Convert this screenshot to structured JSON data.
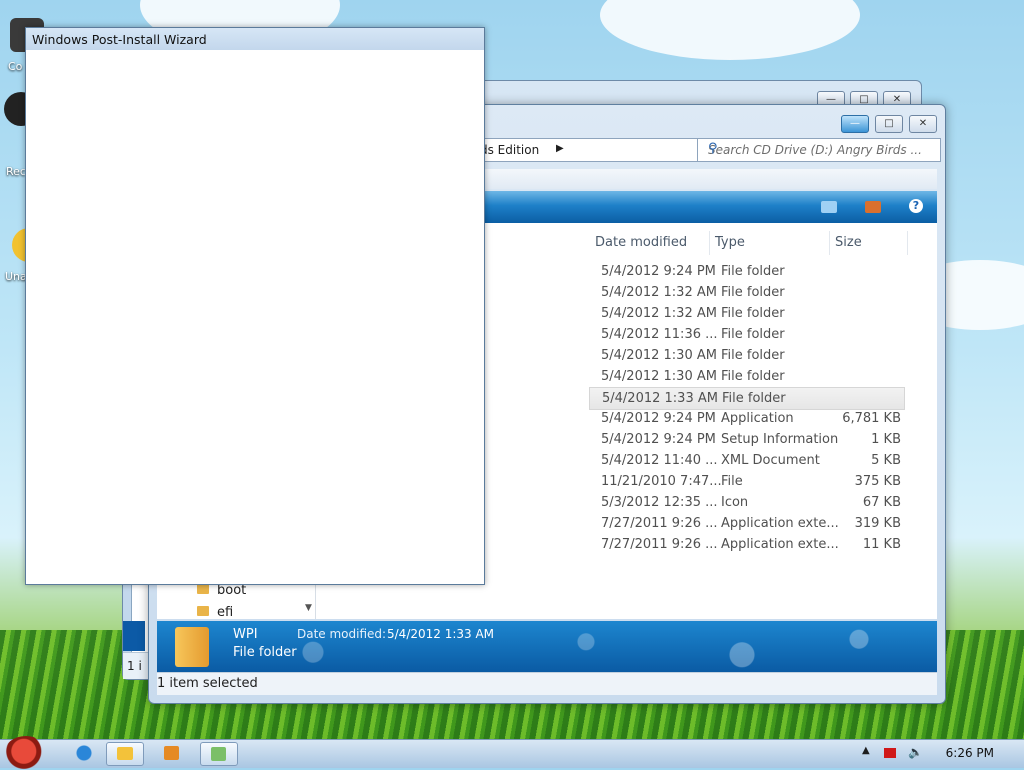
{
  "desktop": {
    "icons": [
      {
        "label": "Co",
        "icon": "computer-icon"
      },
      {
        "label": "Rec",
        "icon": "recycle-bin-icon"
      },
      {
        "label": "Una",
        "icon": "uninstall-icon"
      }
    ]
  },
  "wizard": {
    "title": "Windows Post-Install Wizard"
  },
  "back_window": {
    "status_text": "1 i"
  },
  "explorer": {
    "address_text": "ds Edition",
    "search_placeholder": "Search CD Drive (D:) Angry Birds ...",
    "columns": {
      "date_modified": "Date modified",
      "type": "Type",
      "size": "Size"
    },
    "rows": [
      {
        "date": "5/4/2012 9:24 PM",
        "type": "File folder",
        "size": ""
      },
      {
        "date": "5/4/2012 1:32 AM",
        "type": "File folder",
        "size": ""
      },
      {
        "date": "5/4/2012 1:32 AM",
        "type": "File folder",
        "size": ""
      },
      {
        "date": "5/4/2012 11:36 ...",
        "type": "File folder",
        "size": ""
      },
      {
        "date": "5/4/2012 1:30 AM",
        "type": "File folder",
        "size": ""
      },
      {
        "date": "5/4/2012 1:30 AM",
        "type": "File folder",
        "size": ""
      },
      {
        "date": "5/4/2012 1:33 AM",
        "type": "File folder",
        "size": "",
        "selected": true
      },
      {
        "date": "5/4/2012 9:24 PM",
        "type": "Application",
        "size": "6,781 KB"
      },
      {
        "date": "5/4/2012 9:24 PM",
        "type": "Setup Information",
        "size": "1 KB"
      },
      {
        "date": "5/4/2012 11:40 ...",
        "type": "XML Document",
        "size": "5 KB"
      },
      {
        "date": "11/21/2010 7:47...",
        "type": "File",
        "size": "375 KB"
      },
      {
        "date": "5/3/2012 12:35 ...",
        "type": "Icon",
        "size": "67 KB"
      },
      {
        "date": "7/27/2011 9:26 ...",
        "type": "Application exte...",
        "size": "319 KB"
      },
      {
        "date": "7/27/2011 9:26 ...",
        "type": "Application exte...",
        "size": "11 KB"
      }
    ],
    "tree": [
      {
        "label": "boot"
      },
      {
        "label": "efi"
      }
    ],
    "details": {
      "name": "WPI",
      "kind": "File folder",
      "date_label": "Date modified:",
      "date_value": "5/4/2012 1:33 AM"
    },
    "status_text": "1 item selected"
  },
  "taskbar": {
    "clock": "6:26 PM"
  },
  "colors": {
    "toolbar_blue": "#1e80c8",
    "selection_gray": "#e6e6e6",
    "taskbar": "#c0d6ec"
  }
}
